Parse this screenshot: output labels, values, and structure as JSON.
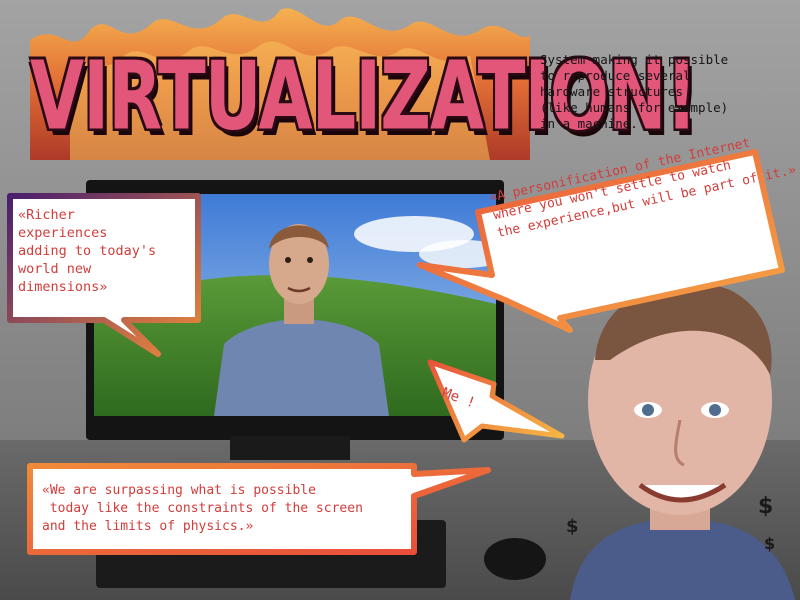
{
  "title": "VIRTUALIZATION!",
  "definition": "System making it possible\nto reproduce several\nhardware structures\n(like humans for example)\nin a machine.",
  "bubbles": {
    "richer": "«Richer\nexperiences\nadding to today's\nworld new\ndimensions»",
    "internet": "«A personification of the Internet\nwhere you won't settle to watch\nthe experience,but will be part of it.»",
    "me": "Me !",
    "surpassing": "«We are surpassing what is possible\n today like the constraints of the screen\nand the limits of physics.»"
  },
  "dollar_sign": "$",
  "colors": {
    "title_fill": "#e2567a",
    "bubble_text": "#d23d3a",
    "bubble_border_orange": "#f08a3a"
  }
}
